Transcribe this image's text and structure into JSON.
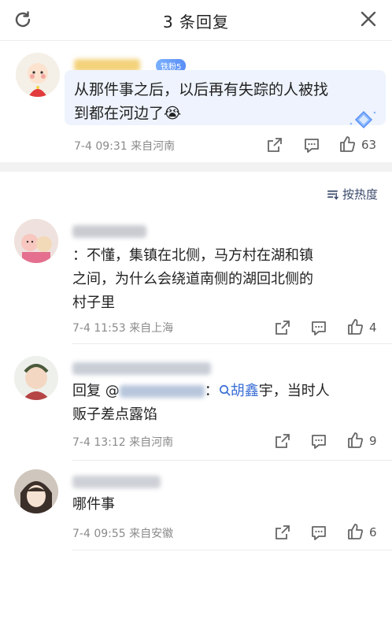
{
  "header": {
    "title": "3 条回复"
  },
  "top_comment": {
    "badge": "铁粉5",
    "text_line1": "从那件事之后，以后再有失踪的人被找",
    "text_line2": "到都在河边了😭",
    "meta": "7-4 09:31 来自河南",
    "like_count": "63"
  },
  "sort": {
    "label": "按热度"
  },
  "replies": [
    {
      "line1": "：不懂，集镇在北侧，马方村在湖和镇",
      "line2": "之间，为什么会绕道南侧的湖回北侧的",
      "line3": "村子里",
      "meta": "7-4 11:53 来自上海",
      "like_count": "4"
    },
    {
      "prefix": "回复 @",
      "colon": "：",
      "search_term": "胡鑫",
      "rest": "宇，当时人",
      "line2": "贩子差点露馅",
      "meta": "7-4 13:12 来自河南",
      "like_count": "9"
    },
    {
      "line1": "哪件事",
      "meta": "7-4 09:55 来自安徽",
      "like_count": "6"
    }
  ]
}
